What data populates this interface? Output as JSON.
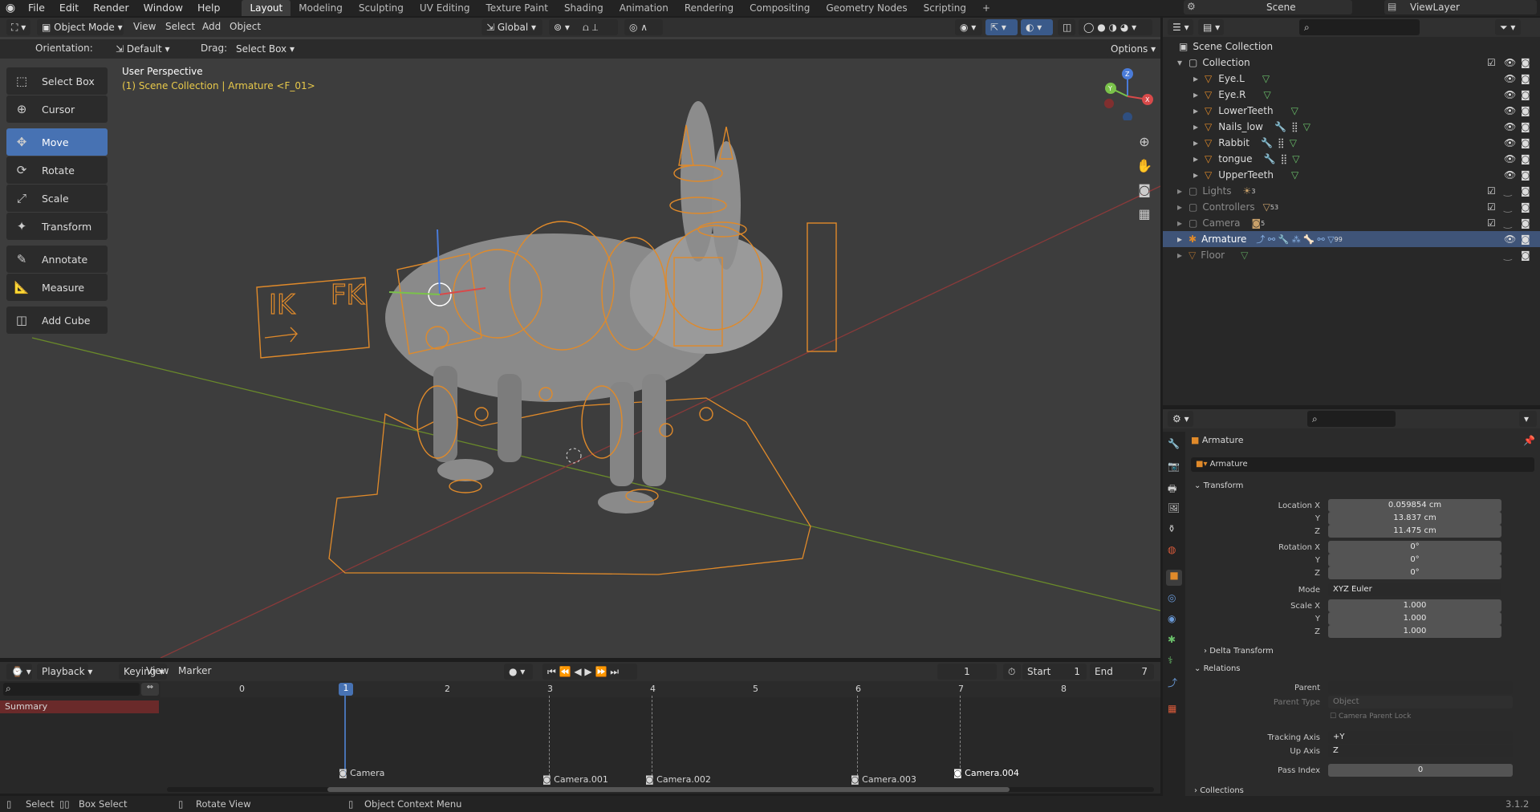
{
  "app": {
    "logo": "blender-logo-icon",
    "version": "3.1.2"
  },
  "menu": [
    "File",
    "Edit",
    "Render",
    "Window",
    "Help"
  ],
  "workspaces": [
    "Layout",
    "Modeling",
    "Sculpting",
    "UV Editing",
    "Texture Paint",
    "Shading",
    "Animation",
    "Rendering",
    "Compositing",
    "Geometry Nodes",
    "Scripting"
  ],
  "active_workspace": "Layout",
  "scene": {
    "label": "Scene",
    "viewlayer": "ViewLayer"
  },
  "viewport_header": {
    "mode": "Object Mode",
    "menus": [
      "View",
      "Select",
      "Add",
      "Object"
    ],
    "transform_orientation": "Global",
    "options": "Options"
  },
  "tool_settings": {
    "orientation_label": "Orientation:",
    "orientation_value": "Default",
    "drag_label": "Drag:",
    "drag_value": "Select Box"
  },
  "viewport": {
    "view_name": "User Perspective",
    "context": "(1) Scene Collection | Armature <F_01>"
  },
  "tools": [
    "Select Box",
    "Cursor",
    "Move",
    "Rotate",
    "Scale",
    "Transform",
    "Annotate",
    "Measure",
    "Add Cube"
  ],
  "active_tool": "Move",
  "gizmo": {
    "z": "Z",
    "x": "X",
    "y": "Y"
  },
  "outliner": {
    "root": "Scene Collection",
    "rows": [
      {
        "name": "Collection",
        "indent": 1
      },
      {
        "name": "Eye.L",
        "indent": 2
      },
      {
        "name": "Eye.R",
        "indent": 2
      },
      {
        "name": "LowerTeeth",
        "indent": 2
      },
      {
        "name": "Nails_low",
        "indent": 2
      },
      {
        "name": "Rabbit",
        "indent": 2
      },
      {
        "name": "tongue",
        "indent": 2
      },
      {
        "name": "UpperTeeth",
        "indent": 2
      },
      {
        "name": "Lights",
        "indent": 1,
        "badge": "3"
      },
      {
        "name": "Controllers",
        "indent": 1,
        "badge": "53"
      },
      {
        "name": "Camera",
        "indent": 1,
        "badge": "5"
      },
      {
        "name": "Armature",
        "indent": 1,
        "badge": "99"
      },
      {
        "name": "Floor",
        "indent": 1
      }
    ]
  },
  "properties": {
    "object_name": "Armature",
    "data_name": "Armature",
    "transform_title": "Transform",
    "location_label": "Location X",
    "location": [
      "0.059854 cm",
      "13.837 cm",
      "11.475 cm"
    ],
    "rotation_label": "Rotation X",
    "rotation": [
      "0°",
      "0°",
      "0°"
    ],
    "mode_label": "Mode",
    "mode_value": "XYZ Euler",
    "scale_label": "Scale X",
    "scale": [
      "1.000",
      "1.000",
      "1.000"
    ],
    "y": "Y",
    "z": "Z",
    "delta_title": "Delta Transform",
    "relations_title": "Relations",
    "parent_label": "Parent",
    "parent_type_label": "Parent Type",
    "parent_type_value": "Object",
    "camera_parent_lock": "Camera Parent Lock",
    "tracking_axis_label": "Tracking Axis",
    "tracking_axis_value": "+Y",
    "up_axis_label": "Up Axis",
    "up_axis_value": "Z",
    "pass_index_label": "Pass Index",
    "pass_index_value": "0",
    "collections_title": "Collections"
  },
  "timeline": {
    "menus": [
      "Playback",
      "Keying",
      "View",
      "Marker"
    ],
    "current_frame": "1",
    "start_label": "Start",
    "start": "1",
    "end_label": "End",
    "end": "7",
    "ruler": [
      "0",
      "1",
      "2",
      "3",
      "4",
      "5",
      "6",
      "7",
      "8"
    ],
    "summary": "Summary",
    "markers": [
      "Camera",
      "Camera.001",
      "Camera.002",
      "Camera.003",
      "Camera.004"
    ]
  },
  "statusbar": {
    "select": "Select",
    "box_select": "Box Select",
    "rotate_view": "Rotate View",
    "context_menu": "Object Context Menu"
  },
  "colors": {
    "accent": "#4772b3",
    "armature": "#e08a2a",
    "selected_row": "#3f5478"
  }
}
